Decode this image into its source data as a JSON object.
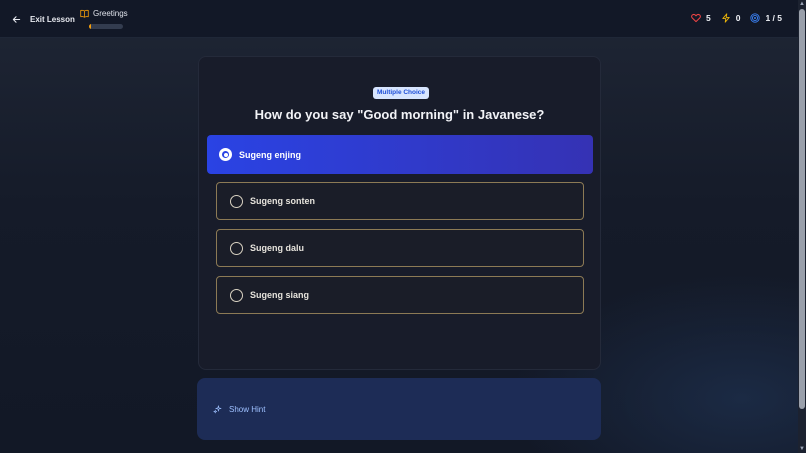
{
  "header": {
    "exit_label": "Exit Lesson",
    "lesson_title": "Greetings",
    "lesson_progress_fraction": 0.05,
    "hearts": "5",
    "streak": "0",
    "question_counter": "1 / 5"
  },
  "question": {
    "type_badge": "Multiple Choice",
    "prompt": "How do you say \"Good morning\" in Javanese?",
    "options": [
      {
        "label": "Sugeng enjing",
        "selected": true
      },
      {
        "label": "Sugeng sonten",
        "selected": false
      },
      {
        "label": "Sugeng dalu",
        "selected": false
      },
      {
        "label": "Sugeng siang",
        "selected": false
      }
    ]
  },
  "hint": {
    "label": "Show Hint"
  },
  "colors": {
    "accent": "#2a43e4",
    "heart": "#ef4444",
    "streak": "#eab308",
    "target": "#3b82f6",
    "option_border": "#8c7a55",
    "badge_bg": "#d7e5ff"
  }
}
